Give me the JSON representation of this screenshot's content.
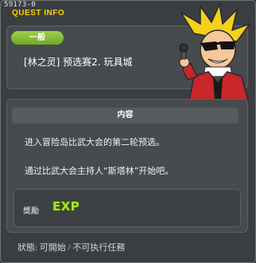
{
  "window": {
    "id_text": "59173-0",
    "title": "QUEST INFO"
  },
  "quest": {
    "category": "一般",
    "name": "[林之灵] 预选赛2. 玩具城"
  },
  "content": {
    "header": "内容",
    "lines": [
      "进入冒险岛比武大会的第二轮预选。",
      "通过比武大会主持人“斯塔林”开始吧。"
    ]
  },
  "reward": {
    "label": "獎勵",
    "items": [
      {
        "icon": "exp-icon",
        "text": "EXP"
      }
    ]
  },
  "status": {
    "text": "狀態: 可開始 / 不可执行任務"
  },
  "colors": {
    "title": "#ffd400",
    "badge": "#8cc63f",
    "exp": "#a6e332",
    "panel": "#474b4e",
    "window": "#3a3e41"
  },
  "npc": {
    "icon": "npc-host-portrait"
  }
}
